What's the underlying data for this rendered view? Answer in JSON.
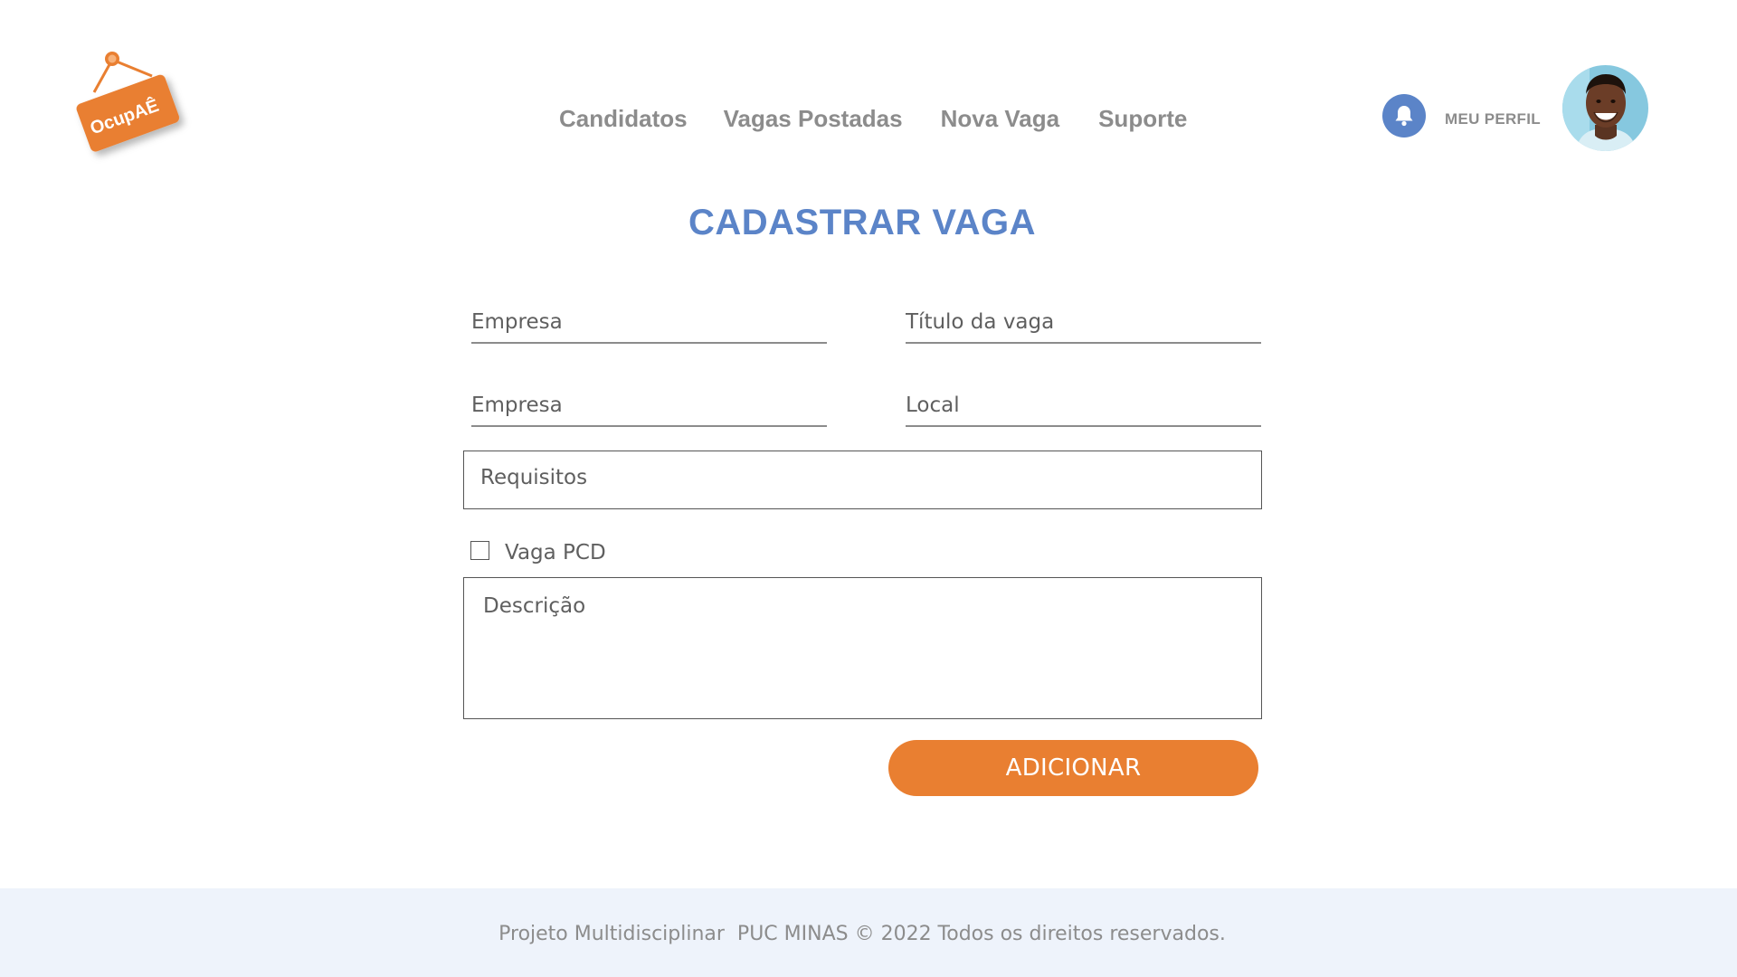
{
  "brand": {
    "logo_text": "OcupAÊ",
    "accent_color": "#e97f31",
    "primary_color": "#5b84c8"
  },
  "nav": {
    "items": [
      {
        "label": "Candidatos"
      },
      {
        "label": "Vagas Postadas"
      },
      {
        "label": "Nova Vaga"
      },
      {
        "label": "Suporte"
      }
    ]
  },
  "header": {
    "notification_icon": "bell-icon",
    "profile_label": "MEU PERFIL",
    "avatar": "user-avatar"
  },
  "main": {
    "title": "CADASTRAR VAGA",
    "form": {
      "empresa_placeholder": "Empresa",
      "titulo_placeholder": "Título da vaga",
      "empresa2_placeholder": "Empresa",
      "local_placeholder": "Local",
      "requisitos_placeholder": "Requisitos",
      "pcd_label": "Vaga PCD",
      "pcd_checked": false,
      "descricao_placeholder": "Descrição",
      "submit_label": "ADICIONAR"
    }
  },
  "footer": {
    "text": "Projeto Multidisciplinar  PUC MINAS © 2022 Todos os direitos reservados."
  }
}
